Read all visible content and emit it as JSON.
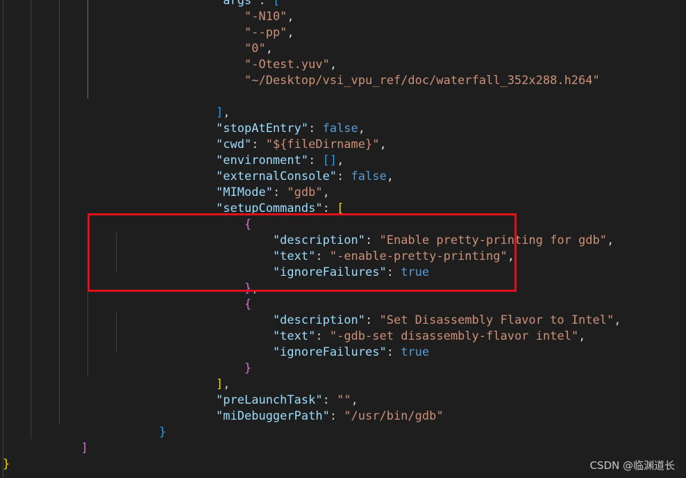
{
  "editor": {
    "colors": {
      "background": "#1e1e1e",
      "key": "#9cdcfe",
      "string": "#ce9178",
      "keyword": "#569cd6",
      "punctuation": "#d4d4d4",
      "bracket_level_1": "#ffd700",
      "bracket_level_2": "#da70d6",
      "bracket_level_3": "#179fff",
      "highlight_border": "#e0111b"
    },
    "lines": [
      {
        "tokens": [
          {
            "t": "p",
            "v": "                              "
          },
          {
            "t": "key",
            "v": "\"args\""
          },
          {
            "t": "p",
            "v": ": "
          },
          {
            "t": "b-b",
            "v": "["
          }
        ]
      },
      {
        "tokens": [
          {
            "t": "p",
            "v": "                                  "
          },
          {
            "t": "str",
            "v": "\"-N10\""
          },
          {
            "t": "p",
            "v": ","
          }
        ]
      },
      {
        "tokens": [
          {
            "t": "p",
            "v": "                                  "
          },
          {
            "t": "str",
            "v": "\"--pp\""
          },
          {
            "t": "p",
            "v": ","
          }
        ]
      },
      {
        "tokens": [
          {
            "t": "p",
            "v": "                                  "
          },
          {
            "t": "str",
            "v": "\"0\""
          },
          {
            "t": "p",
            "v": ","
          }
        ]
      },
      {
        "tokens": [
          {
            "t": "p",
            "v": "                                  "
          },
          {
            "t": "str",
            "v": "\"-Otest.yuv\""
          },
          {
            "t": "p",
            "v": ","
          }
        ]
      },
      {
        "tokens": [
          {
            "t": "p",
            "v": "                                  "
          },
          {
            "t": "str",
            "v": "\"~/Desktop/vsi_vpu_ref/doc/waterfall_352x288.h264\""
          }
        ]
      },
      {
        "tokens": []
      },
      {
        "tokens": [
          {
            "t": "p",
            "v": "                              "
          },
          {
            "t": "b-b",
            "v": "]"
          },
          {
            "t": "p",
            "v": ","
          }
        ]
      },
      {
        "tokens": [
          {
            "t": "p",
            "v": "                              "
          },
          {
            "t": "key",
            "v": "\"stopAtEntry\""
          },
          {
            "t": "p",
            "v": ": "
          },
          {
            "t": "kw",
            "v": "false"
          },
          {
            "t": "p",
            "v": ","
          }
        ]
      },
      {
        "tokens": [
          {
            "t": "p",
            "v": "                              "
          },
          {
            "t": "key",
            "v": "\"cwd\""
          },
          {
            "t": "p",
            "v": ": "
          },
          {
            "t": "str",
            "v": "\"${fileDirname}\""
          },
          {
            "t": "p",
            "v": ","
          }
        ]
      },
      {
        "tokens": [
          {
            "t": "p",
            "v": "                              "
          },
          {
            "t": "key",
            "v": "\"environment\""
          },
          {
            "t": "p",
            "v": ": "
          },
          {
            "t": "b-b",
            "v": "[]"
          },
          {
            "t": "p",
            "v": ","
          }
        ]
      },
      {
        "tokens": [
          {
            "t": "p",
            "v": "                              "
          },
          {
            "t": "key",
            "v": "\"externalConsole\""
          },
          {
            "t": "p",
            "v": ": "
          },
          {
            "t": "kw",
            "v": "false"
          },
          {
            "t": "p",
            "v": ","
          }
        ]
      },
      {
        "tokens": [
          {
            "t": "p",
            "v": "                              "
          },
          {
            "t": "key",
            "v": "\"MIMode\""
          },
          {
            "t": "p",
            "v": ": "
          },
          {
            "t": "str",
            "v": "\"gdb\""
          },
          {
            "t": "p",
            "v": ","
          }
        ]
      },
      {
        "tokens": [
          {
            "t": "p",
            "v": "                              "
          },
          {
            "t": "key",
            "v": "\"setupCommands\""
          },
          {
            "t": "p",
            "v": ": "
          },
          {
            "t": "b-y",
            "v": "["
          }
        ]
      },
      {
        "tokens": [
          {
            "t": "p",
            "v": "                                  "
          },
          {
            "t": "b-m",
            "v": "{"
          }
        ]
      },
      {
        "tokens": [
          {
            "t": "p",
            "v": "                                      "
          },
          {
            "t": "key",
            "v": "\"description\""
          },
          {
            "t": "p",
            "v": ": "
          },
          {
            "t": "str",
            "v": "\"Enable pretty-printing for gdb\""
          },
          {
            "t": "p",
            "v": ","
          }
        ]
      },
      {
        "tokens": [
          {
            "t": "p",
            "v": "                                      "
          },
          {
            "t": "key",
            "v": "\"text\""
          },
          {
            "t": "p",
            "v": ": "
          },
          {
            "t": "str",
            "v": "\"-enable-pretty-printing\""
          },
          {
            "t": "p",
            "v": ","
          }
        ]
      },
      {
        "tokens": [
          {
            "t": "p",
            "v": "                                      "
          },
          {
            "t": "key",
            "v": "\"ignoreFailures\""
          },
          {
            "t": "p",
            "v": ": "
          },
          {
            "t": "kw",
            "v": "true"
          }
        ]
      },
      {
        "tokens": [
          {
            "t": "p",
            "v": "                                  "
          },
          {
            "t": "b-m",
            "v": "}"
          },
          {
            "t": "p",
            "v": ","
          }
        ]
      },
      {
        "tokens": [
          {
            "t": "p",
            "v": "                                  "
          },
          {
            "t": "b-m",
            "v": "{"
          }
        ]
      },
      {
        "tokens": [
          {
            "t": "p",
            "v": "                                      "
          },
          {
            "t": "key",
            "v": "\"description\""
          },
          {
            "t": "p",
            "v": ": "
          },
          {
            "t": "str",
            "v": "\"Set Disassembly Flavor to Intel\""
          },
          {
            "t": "p",
            "v": ","
          }
        ]
      },
      {
        "tokens": [
          {
            "t": "p",
            "v": "                                      "
          },
          {
            "t": "key",
            "v": "\"text\""
          },
          {
            "t": "p",
            "v": ": "
          },
          {
            "t": "str",
            "v": "\"-gdb-set disassembly-flavor intel\""
          },
          {
            "t": "p",
            "v": ","
          }
        ]
      },
      {
        "tokens": [
          {
            "t": "p",
            "v": "                                      "
          },
          {
            "t": "key",
            "v": "\"ignoreFailures\""
          },
          {
            "t": "p",
            "v": ": "
          },
          {
            "t": "kw",
            "v": "true"
          }
        ]
      },
      {
        "tokens": [
          {
            "t": "p",
            "v": "                                  "
          },
          {
            "t": "b-m",
            "v": "}"
          }
        ]
      },
      {
        "tokens": [
          {
            "t": "p",
            "v": "                              "
          },
          {
            "t": "b-y",
            "v": "]"
          },
          {
            "t": "p",
            "v": ","
          }
        ]
      },
      {
        "tokens": [
          {
            "t": "p",
            "v": "                              "
          },
          {
            "t": "key",
            "v": "\"preLaunchTask\""
          },
          {
            "t": "p",
            "v": ": "
          },
          {
            "t": "str",
            "v": "\"\""
          },
          {
            "t": "p",
            "v": ","
          }
        ]
      },
      {
        "tokens": [
          {
            "t": "p",
            "v": "                              "
          },
          {
            "t": "key",
            "v": "\"miDebuggerPath\""
          },
          {
            "t": "p",
            "v": ": "
          },
          {
            "t": "str",
            "v": "\"/usr/bin/gdb\""
          }
        ]
      },
      {
        "tokens": [
          {
            "t": "p",
            "v": "                      "
          },
          {
            "t": "b-b",
            "v": "}"
          }
        ]
      },
      {
        "tokens": [
          {
            "t": "p",
            "v": "           "
          },
          {
            "t": "b-m",
            "v": "]"
          }
        ]
      },
      {
        "tokens": [
          {
            "t": "b-y",
            "v": "}"
          }
        ]
      }
    ]
  },
  "watermark": {
    "text": "CSDN @临渊道长"
  }
}
